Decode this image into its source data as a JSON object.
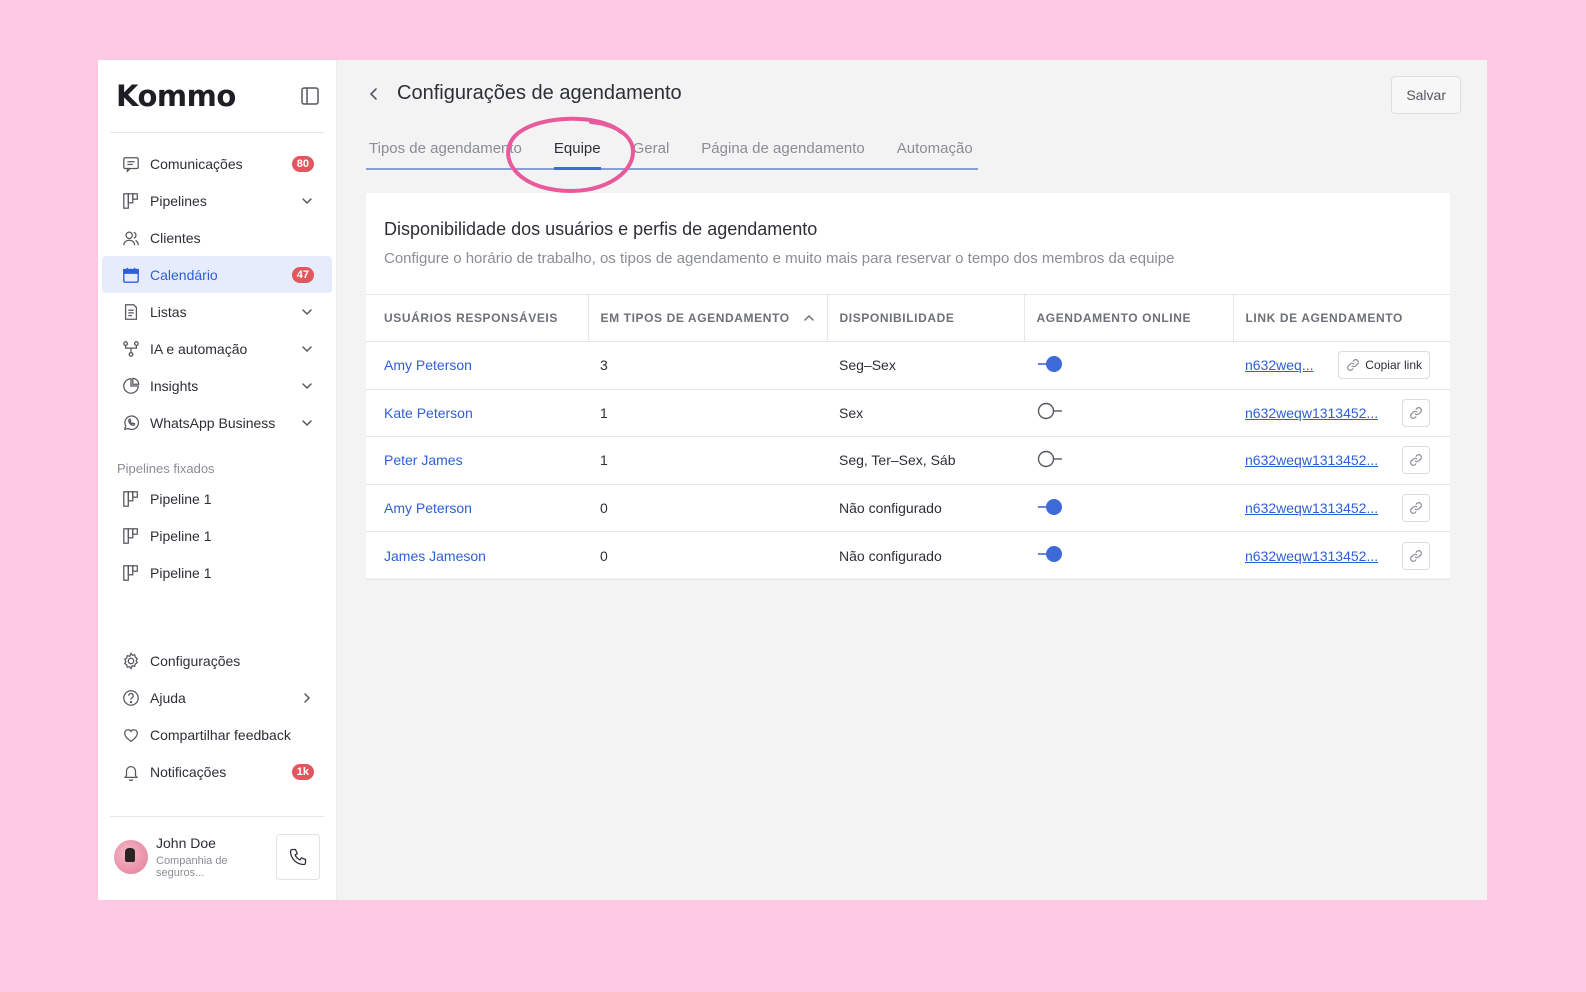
{
  "app": {
    "logo_text": "Kommo"
  },
  "sidebar": {
    "items": [
      {
        "label": "Comunicações",
        "icon": "chat-icon",
        "badge": "80",
        "chevron": false,
        "active": false
      },
      {
        "label": "Pipelines",
        "icon": "pipeline-icon",
        "badge": null,
        "chevron": true,
        "active": false
      },
      {
        "label": "Clientes",
        "icon": "users-icon",
        "badge": null,
        "chevron": false,
        "active": false
      },
      {
        "label": "Calendário",
        "icon": "calendar-icon",
        "badge": "47",
        "chevron": false,
        "active": true
      },
      {
        "label": "Listas",
        "icon": "list-icon",
        "badge": null,
        "chevron": true,
        "active": false
      },
      {
        "label": "IA e automação",
        "icon": "automation-icon",
        "badge": null,
        "chevron": true,
        "active": false
      },
      {
        "label": "Insights",
        "icon": "pie-chart-icon",
        "badge": null,
        "chevron": true,
        "active": false
      },
      {
        "label": "WhatsApp Business",
        "icon": "whatsapp-icon",
        "badge": null,
        "chevron": true,
        "active": false
      }
    ],
    "pinned_title": "Pipelines fixados",
    "pinned": [
      {
        "label": "Pipeline 1"
      },
      {
        "label": "Pipeline 1"
      },
      {
        "label": "Pipeline 1"
      }
    ],
    "bottom_items": [
      {
        "label": "Configurações",
        "icon": "gear-icon",
        "badge": null,
        "chevron_right": false
      },
      {
        "label": "Ajuda",
        "icon": "help-icon",
        "badge": null,
        "chevron_right": true
      },
      {
        "label": "Compartilhar feedback",
        "icon": "heart-icon",
        "badge": null,
        "chevron_right": false
      },
      {
        "label": "Notificações",
        "icon": "bell-icon",
        "badge": "1k",
        "chevron_right": false
      }
    ],
    "user": {
      "name": "John Doe",
      "company": "Companhia de seguros..."
    }
  },
  "header": {
    "title": "Configurações de agendamento",
    "save_label": "Salvar"
  },
  "tabs": [
    {
      "label": "Tipos de agendamento",
      "active": false
    },
    {
      "label": "Equipe",
      "active": true
    },
    {
      "label": "Geral",
      "active": false
    },
    {
      "label": "Página de agendamento",
      "active": false
    },
    {
      "label": "Automação",
      "active": false
    }
  ],
  "card": {
    "title": "Disponibilidade dos usuários e perfis de agendamento",
    "subtitle": "Configure o horário de trabalho, os tipos de agendamento e muito mais para reservar o tempo dos membros da equipe"
  },
  "table": {
    "columns": [
      "USUÁRIOS RESPONSÁVEIS",
      "EM TIPOS DE AGENDAMENTO",
      "DISPONIBILIDADE",
      "AGENDAMENTO ONLINE",
      "LINK DE AGENDAMENTO"
    ],
    "copy_label": "Copiar link",
    "rows": [
      {
        "user": "Amy Peterson",
        "types": "3",
        "availability": "Seg–Sex",
        "online": true,
        "link": "n632weq...",
        "copy_text_button": true
      },
      {
        "user": "Kate Peterson",
        "types": "1",
        "availability": "Sex",
        "online": false,
        "link": "n632weqw1313452...",
        "copy_text_button": false
      },
      {
        "user": "Peter James",
        "types": "1",
        "availability": "Seg, Ter–Sex, Sáb",
        "online": false,
        "link": "n632weqw1313452...",
        "copy_text_button": false
      },
      {
        "user": "Amy Peterson",
        "types": "0",
        "availability": "Não configurado",
        "online": true,
        "link": "n632weqw1313452...",
        "copy_text_button": false
      },
      {
        "user": "James Jameson",
        "types": "0",
        "availability": "Não configurado",
        "online": true,
        "link": "n632weqw1313452...",
        "copy_text_button": false
      }
    ]
  },
  "colors": {
    "background": "#fcc8e2",
    "accent": "#3e6ad8",
    "badge": "#e0575e",
    "highlight_circle": "#e85a9c"
  }
}
